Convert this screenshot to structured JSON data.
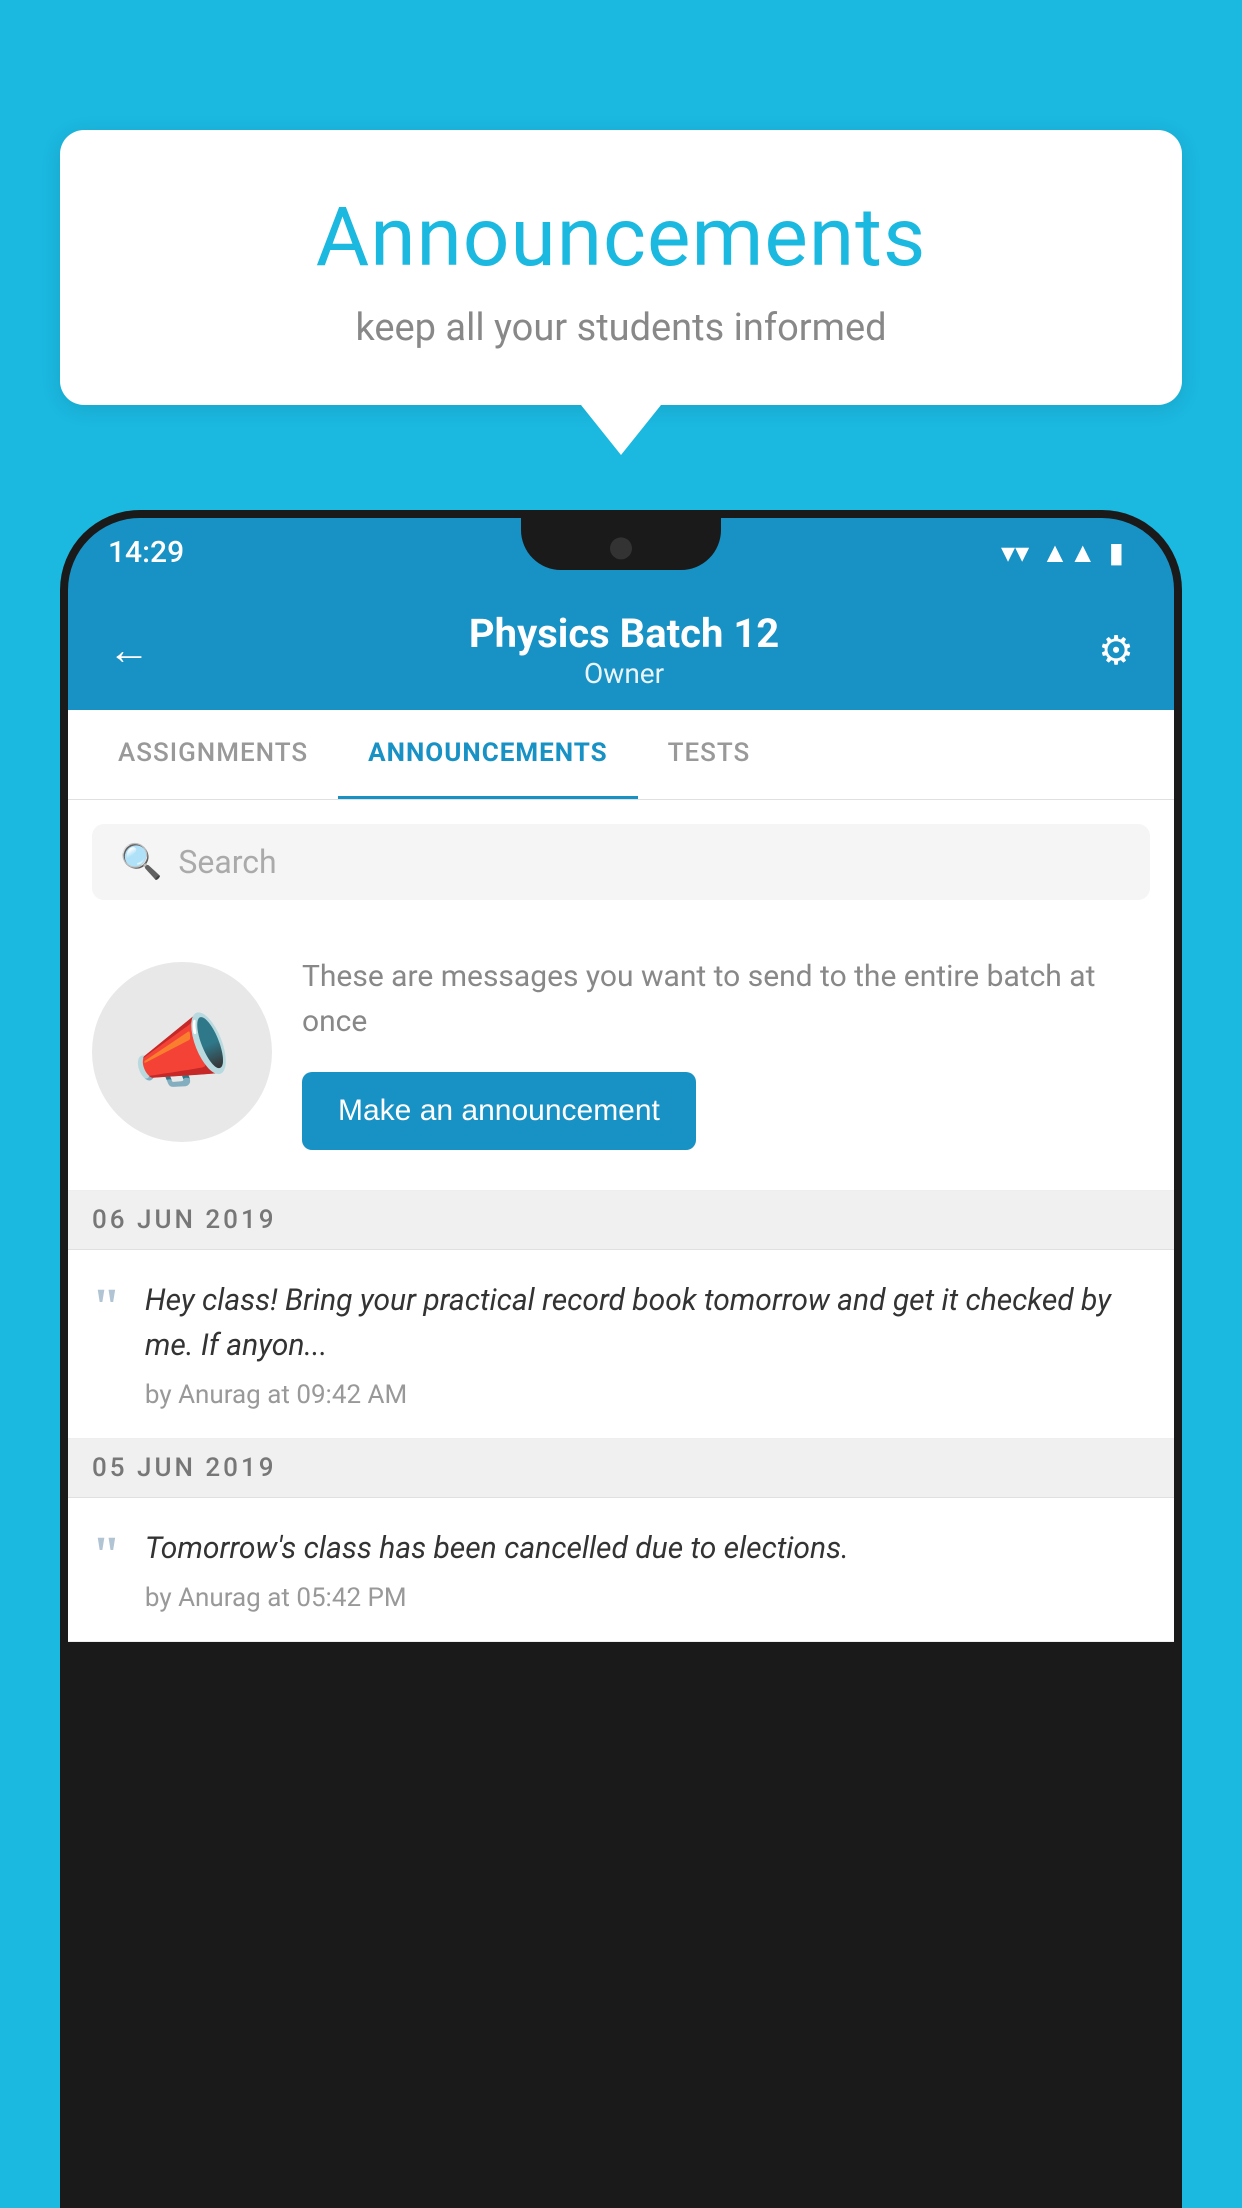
{
  "background_color": "#1bb8e0",
  "speech_bubble": {
    "title": "Announcements",
    "subtitle": "keep all your students informed"
  },
  "phone": {
    "status_bar": {
      "time": "14:29",
      "icons": [
        "wifi",
        "signal",
        "battery"
      ]
    },
    "header": {
      "title": "Physics Batch 12",
      "subtitle": "Owner",
      "back_label": "←",
      "settings_label": "⚙"
    },
    "tabs": [
      {
        "label": "ASSIGNMENTS",
        "active": false
      },
      {
        "label": "ANNOUNCEMENTS",
        "active": true
      },
      {
        "label": "TESTS",
        "active": false
      }
    ],
    "search": {
      "placeholder": "Search"
    },
    "empty_state": {
      "description": "These are messages you want to send to the entire batch at once",
      "button_label": "Make an announcement"
    },
    "announcements": [
      {
        "date": "06  JUN  2019",
        "text": "Hey class! Bring your practical record book tomorrow and get it checked by me. If anyon...",
        "meta": "by Anurag at 09:42 AM"
      },
      {
        "date": "05  JUN  2019",
        "text": "Tomorrow's class has been cancelled due to elections.",
        "meta": "by Anurag at 05:42 PM"
      }
    ]
  }
}
